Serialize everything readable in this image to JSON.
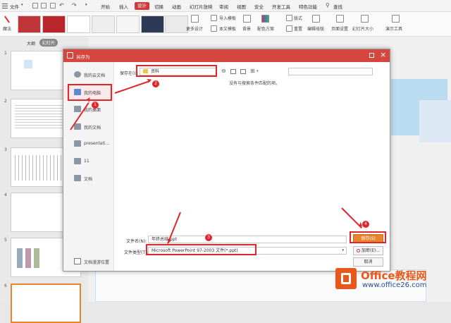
{
  "menubar": {
    "file_label": "文件",
    "tabs": [
      "开始",
      "插入",
      "设计",
      "切换",
      "动画",
      "幻灯片放映",
      "审阅",
      "视图",
      "安全",
      "开发工具",
      "特色功能"
    ],
    "active_tab": "设计",
    "search_label": "查找"
  },
  "ribbon": {
    "magic_label": "魔法",
    "more_design_label": "更多设计",
    "import_template_label": "导入模板",
    "text_template_label": "本文模板",
    "background_label": "背景",
    "color_scheme_label": "配色方案",
    "format_label": "版式",
    "reset_label": "重置",
    "edit_master_label": "编辑母版",
    "page_setup_label": "页面设置",
    "slide_size_label": "幻灯片大小",
    "presenter_tools_label": "演示工具",
    "accent_color": "#d03a3a"
  },
  "leftpanel": {
    "tab_outline": "大纲",
    "tab_slides": "幻灯片",
    "slide_numbers": [
      "1",
      "2",
      "3",
      "4",
      "5",
      "6"
    ]
  },
  "dialog": {
    "title": "另存为",
    "sidebar": [
      {
        "label": "我的云文档",
        "icon": "cloud-icon"
      },
      {
        "label": "我的电脑",
        "icon": "computer-icon"
      },
      {
        "label": "我的桌面",
        "icon": "desktop-icon"
      },
      {
        "label": "我的文档",
        "icon": "folder-icon"
      },
      {
        "label": "presentati...",
        "icon": "folder-icon"
      },
      {
        "label": "11",
        "icon": "folder-icon"
      },
      {
        "label": "文档",
        "icon": "folder-icon"
      }
    ],
    "save_location_label": "保存在(I):",
    "save_location_value": "资料",
    "empty_message": "没有与搜索条件匹配的项。",
    "filename_label": "文件名(N):",
    "filename_value": "年终总结.ppt",
    "filetype_label": "文件类型(T):",
    "filetype_value": "Microsoft PowerPoint 97-2003 文件(*.ppt)",
    "save_button": "保存(S)",
    "encrypt_button": "加密(E)...",
    "cancel_button": "取消",
    "location_footer": "文档漫游位置"
  },
  "badges": [
    "1",
    "2",
    "3",
    "4"
  ],
  "watermark": {
    "brand": "Office教程网",
    "url": "www.office26.com"
  },
  "colors": {
    "dialog_title": "#d4463e",
    "annotation": "#e0262b",
    "save_button": "#e8842b",
    "watermark_orange": "#e8581c"
  }
}
